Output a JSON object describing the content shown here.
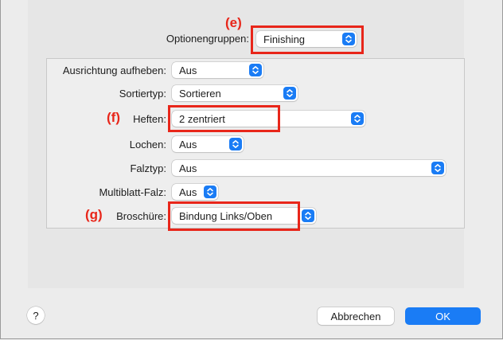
{
  "optionGroups": {
    "label": "Optionengruppen:",
    "value": "Finishing",
    "annotation": "(e)"
  },
  "rows": [
    {
      "label": "Ausrichtung aufheben:",
      "value": "Aus"
    },
    {
      "label": "Sortiertyp:",
      "value": "Sortieren"
    },
    {
      "label": "Heften:",
      "value": "2 zentriert",
      "annotation": "(f)"
    },
    {
      "label": "Lochen:",
      "value": "Aus"
    },
    {
      "label": "Falztyp:",
      "value": "Aus"
    },
    {
      "label": "Multiblatt-Falz:",
      "value": "Aus"
    },
    {
      "label": "Broschüre:",
      "value": "Bindung Links/Oben",
      "annotation": "(g)"
    }
  ],
  "buttons": {
    "help": "?",
    "cancel": "Abbrechen",
    "ok": "OK"
  },
  "colors": {
    "accent": "#1a7cf5",
    "highlight": "#e8261a",
    "background": "#ececec"
  },
  "icons": {
    "popupIndicator": "up-down-chevron-icon"
  }
}
